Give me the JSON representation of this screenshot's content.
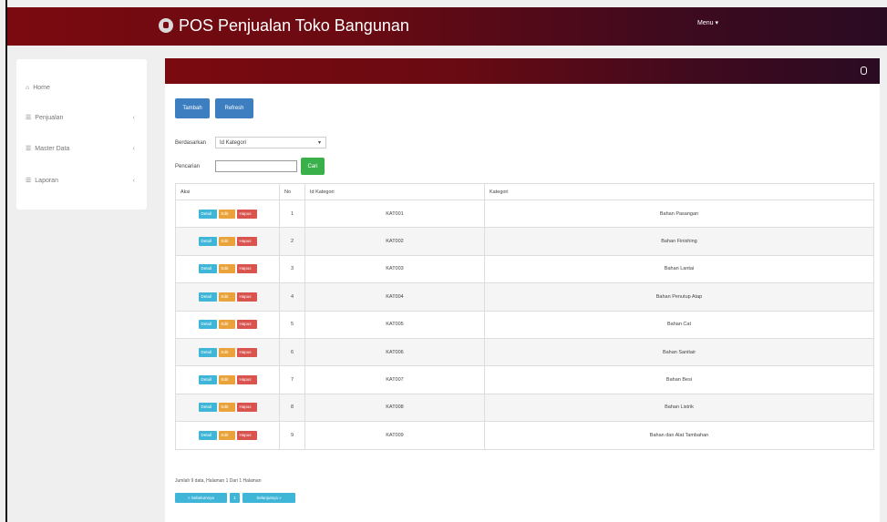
{
  "app": {
    "title": "POS Penjualan Toko Bangunan",
    "menu_label": "Menu ▾"
  },
  "sidebar": {
    "items": [
      {
        "icon": "home-icon",
        "label": "Home",
        "has_children": false
      },
      {
        "icon": "list-icon",
        "label": "Penjualan",
        "has_children": true
      },
      {
        "icon": "list-icon",
        "label": "Master Data",
        "has_children": true
      },
      {
        "icon": "list-icon",
        "label": "Laporan",
        "has_children": true
      }
    ]
  },
  "toolbar": {
    "add_label": "Tambah",
    "refresh_label": "Refresh"
  },
  "filters": {
    "sort_label": "Berdasarkan",
    "sort_value": "Id Kategori",
    "search_label": "Pencarian",
    "search_value": "",
    "search_button": "Cari"
  },
  "table": {
    "headers": [
      "Aksi",
      "No",
      "Id Kategori",
      "Kategori"
    ],
    "action_labels": {
      "detail": "Detail",
      "edit": "Edit",
      "delete": "Hapus"
    },
    "rows": [
      {
        "no": "1",
        "id": "KAT001",
        "kategori": "Bahan Pasangan"
      },
      {
        "no": "2",
        "id": "KAT002",
        "kategori": "Bahan Finishing"
      },
      {
        "no": "3",
        "id": "KAT003",
        "kategori": "Bahan Lantai"
      },
      {
        "no": "4",
        "id": "KAT004",
        "kategori": "Bahan Penutup Atap"
      },
      {
        "no": "5",
        "id": "KAT005",
        "kategori": "Bahan Cat"
      },
      {
        "no": "6",
        "id": "KAT006",
        "kategori": "Bahan Sanitair"
      },
      {
        "no": "7",
        "id": "KAT007",
        "kategori": "Bahan Besi"
      },
      {
        "no": "8",
        "id": "KAT008",
        "kategori": "Bahan Listrik"
      },
      {
        "no": "9",
        "id": "KAT009",
        "kategori": "Bahan dan Alat Tambahan"
      }
    ]
  },
  "footer": {
    "summary": "Jumlah 9 data, Halaman 1 Dari 1 Halaman",
    "prev_label": "« Sebelumnya",
    "current_page": "1",
    "next_label": "Selanjutnya »"
  }
}
